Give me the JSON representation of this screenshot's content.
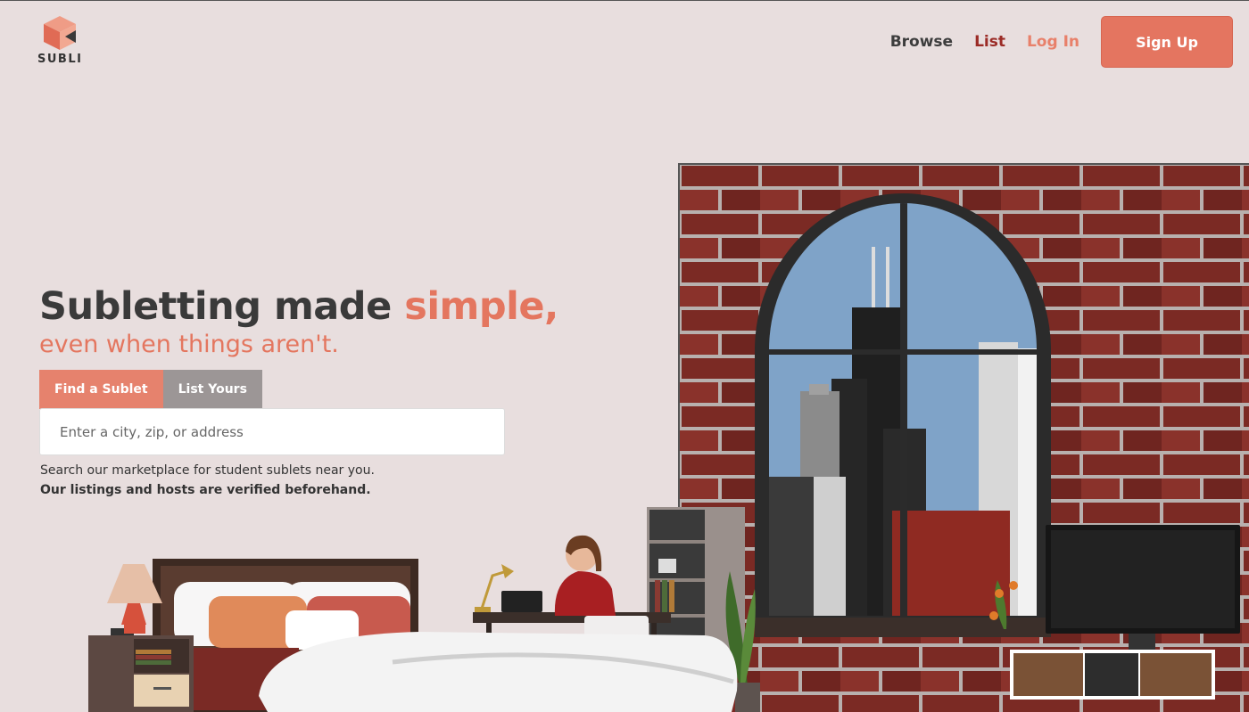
{
  "brand": {
    "name": "SUBLI",
    "primary_color": "#e47560",
    "dark_red": "#9b2b26"
  },
  "nav": {
    "browse": "Browse",
    "list": "List",
    "login": "Log In",
    "signup": "Sign Up"
  },
  "hero": {
    "title_main": "Subletting made ",
    "title_accent": "simple,",
    "subtitle": "even when things aren't."
  },
  "tabs": [
    {
      "label": "Find a Sublet",
      "active": true
    },
    {
      "label": "List Yours",
      "active": false
    }
  ],
  "search": {
    "placeholder": "Enter a city, zip, or address",
    "value": ""
  },
  "description": {
    "line1": "Search our marketplace for student sublets near you.",
    "line2": "Our listings and hosts are verified beforehand."
  },
  "illustration": {
    "scene": "apartment-loft-illustration",
    "icons": [
      "brick-wall",
      "arched-window",
      "city-skyline",
      "bed",
      "lamp",
      "nightstand",
      "desk",
      "person-with-laptop",
      "bookshelf",
      "plant",
      "tv",
      "tv-stand"
    ]
  }
}
